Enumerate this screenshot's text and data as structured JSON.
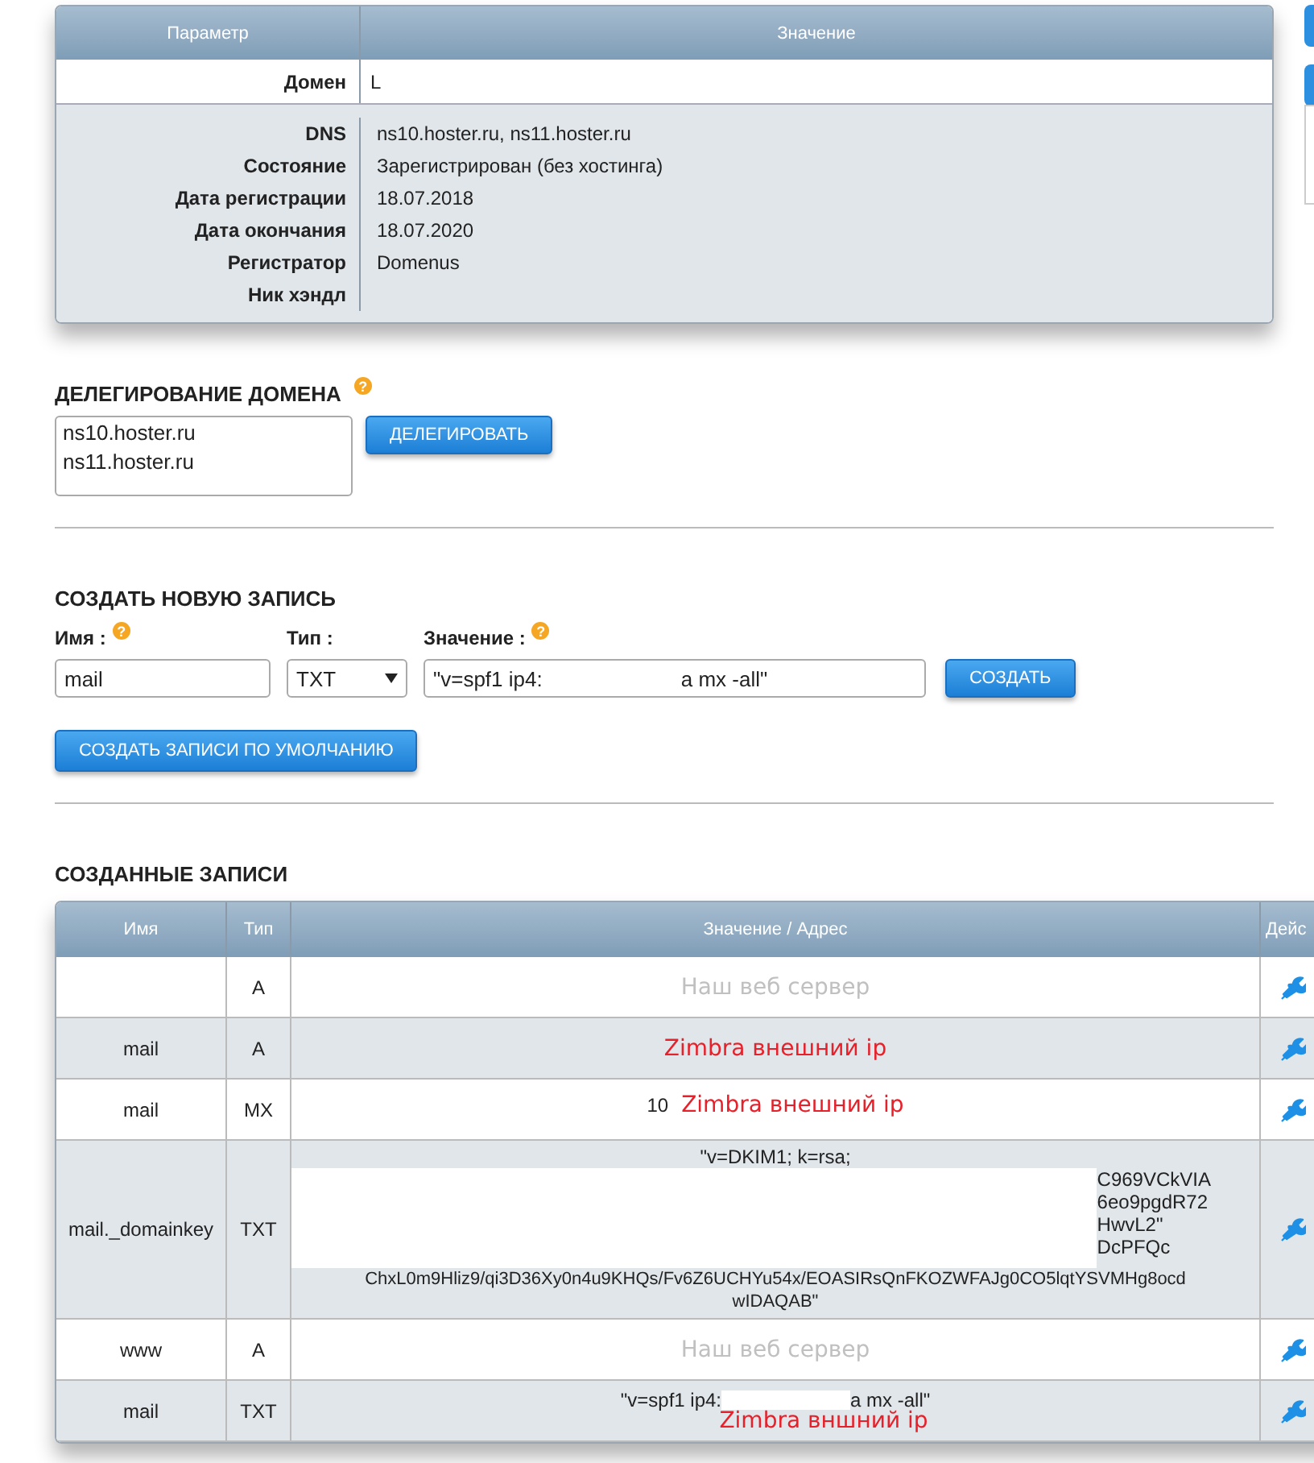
{
  "domain_info": {
    "columns": [
      "Параметр",
      "Значение"
    ],
    "domain_row": {
      "label": "Домен",
      "value": "L"
    },
    "rows": [
      {
        "label": "DNS",
        "value": "ns10.hoster.ru, ns11.hoster.ru"
      },
      {
        "label": "Состояние",
        "value": "Зарегистрирован (без хостинга)"
      },
      {
        "label": "Дата регистрации",
        "value": "18.07.2018"
      },
      {
        "label": "Дата окончания",
        "value": "18.07.2020"
      },
      {
        "label": "Регистратор",
        "value": "Domenus"
      },
      {
        "label": "Ник хэндл",
        "value": ""
      }
    ]
  },
  "delegation": {
    "title": "ДЕЛЕГИРОВАНИЕ ДОМЕНА",
    "help": "?",
    "servers": [
      "ns10.hoster.ru",
      "ns11.hoster.ru"
    ],
    "button": "ДЕЛЕГИРОВАТЬ"
  },
  "create": {
    "title": "СОЗДАТЬ НОВУЮ ЗАПИСЬ",
    "name_label": "Имя :",
    "name_help": "?",
    "name_value": "mail",
    "type_label": "Тип :",
    "type_value": "TXT",
    "value_label": "Значение :",
    "value_help": "?",
    "value_start": "\"v=spf1 ip4:",
    "value_end": "a mx -all\"",
    "button": "СОЗДАТЬ",
    "default_button": "СОЗДАТЬ ЗАПИСИ ПО УМОЛЧАНИЮ"
  },
  "records": {
    "title": "СОЗДАННЫЕ ЗАПИСИ",
    "columns": [
      "Имя",
      "Тип",
      "Значение / Адрес",
      "Дейс"
    ],
    "rows": [
      {
        "name": "",
        "type": "A",
        "kind": "note",
        "value": "Наш веб сервер",
        "color": "#c0c0c0"
      },
      {
        "name": "mail",
        "type": "A",
        "kind": "note",
        "value": "Zimbra внешний ip",
        "color": "#e8202a"
      },
      {
        "name": "mail",
        "type": "MX",
        "kind": "mx",
        "prefix": "10",
        "value": "Zimbra внешний ip",
        "color": "#e8202a"
      },
      {
        "name": "mail._domainkey",
        "type": "TXT",
        "kind": "dkim",
        "lines": [
          "\"v=DKIM1; k=rsa;"
        ],
        "fragments": [
          "C969VCkVIA",
          "6eo9pgdR72",
          "HwvL2\"",
          "DcPFQc"
        ],
        "tail": [
          "ChxL0m9Hliz9/qi3D36Xy0n4u9KHQs/Fv6Z6UCHYu54x/EOASIRsQnFKOZWFAJg0CO5lqtYSVMHg8ocd",
          "wIDAQAB\""
        ]
      },
      {
        "name": "www",
        "type": "A",
        "kind": "note",
        "value": "Наш веб сервер",
        "color": "#c0c0c0"
      },
      {
        "name": "mail",
        "type": "TXT",
        "kind": "spf",
        "start": "\"v=spf1 ip4:",
        "end": "a mx -all\"",
        "value": "Zimbra вншний ip",
        "color": "#e8202a"
      }
    ]
  }
}
